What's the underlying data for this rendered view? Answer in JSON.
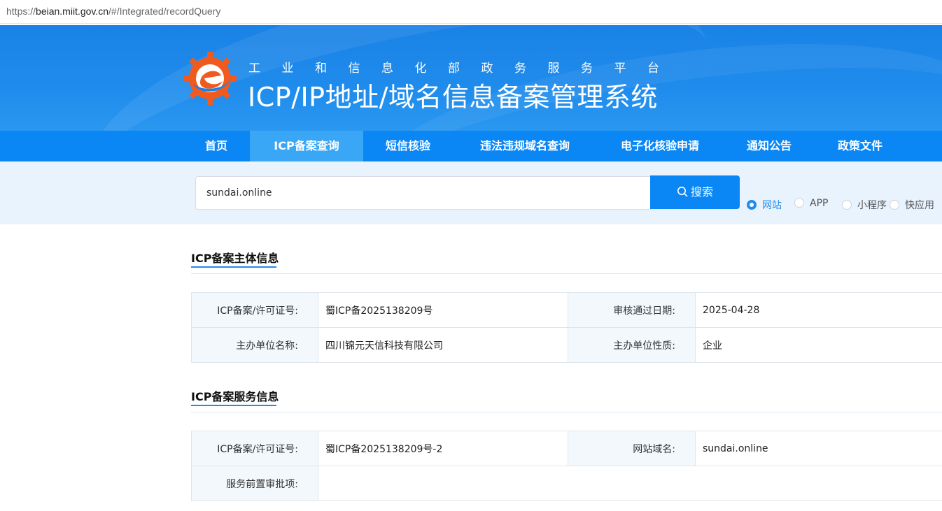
{
  "browser": {
    "url_prefix": "https://",
    "url_host": "beian.miit.gov.cn",
    "url_path": "/#/Integrated/recordQuery"
  },
  "banner": {
    "subtitle": "工业和信息化部政务服务平台",
    "title": "ICP/IP地址/域名信息备案管理系统"
  },
  "nav": [
    {
      "label": "首页"
    },
    {
      "label": "ICP备案查询",
      "active": true
    },
    {
      "label": "短信核验"
    },
    {
      "label": "违法违规域名查询"
    },
    {
      "label": "电子化核验申请"
    },
    {
      "label": "通知公告"
    },
    {
      "label": "政策文件"
    }
  ],
  "search": {
    "value": "sundai.online",
    "button_label": "搜索",
    "options": [
      {
        "label": "网站",
        "selected": true
      },
      {
        "label": "APP",
        "selected": false
      },
      {
        "label": "小程序",
        "selected": false
      },
      {
        "label": "快应用",
        "selected": false
      }
    ]
  },
  "subject": {
    "heading": "ICP备案主体信息",
    "rows": [
      {
        "l1": "ICP备案/许可证号:",
        "v1": "蜀ICP备2025138209号",
        "l2": "审核通过日期:",
        "v2": "2025-04-28"
      },
      {
        "l1": "主办单位名称:",
        "v1": "四川锦元天信科技有限公司",
        "l2": "主办单位性质:",
        "v2": "企业"
      }
    ]
  },
  "service": {
    "heading": "ICP备案服务信息",
    "rows": [
      {
        "l1": "ICP备案/许可证号:",
        "v1": "蜀ICP备2025138209号-2",
        "l2": "网站域名:",
        "v2": "sundai.online"
      },
      {
        "l1": "服务前置审批项:",
        "v1": ""
      }
    ]
  },
  "colors": {
    "primary": "#0a87f5",
    "nav_active": "#3aa6f6",
    "search_band": "#e9f3fd",
    "label_bg": "#f3f8fd",
    "logo_orange": "#f05a1e"
  }
}
